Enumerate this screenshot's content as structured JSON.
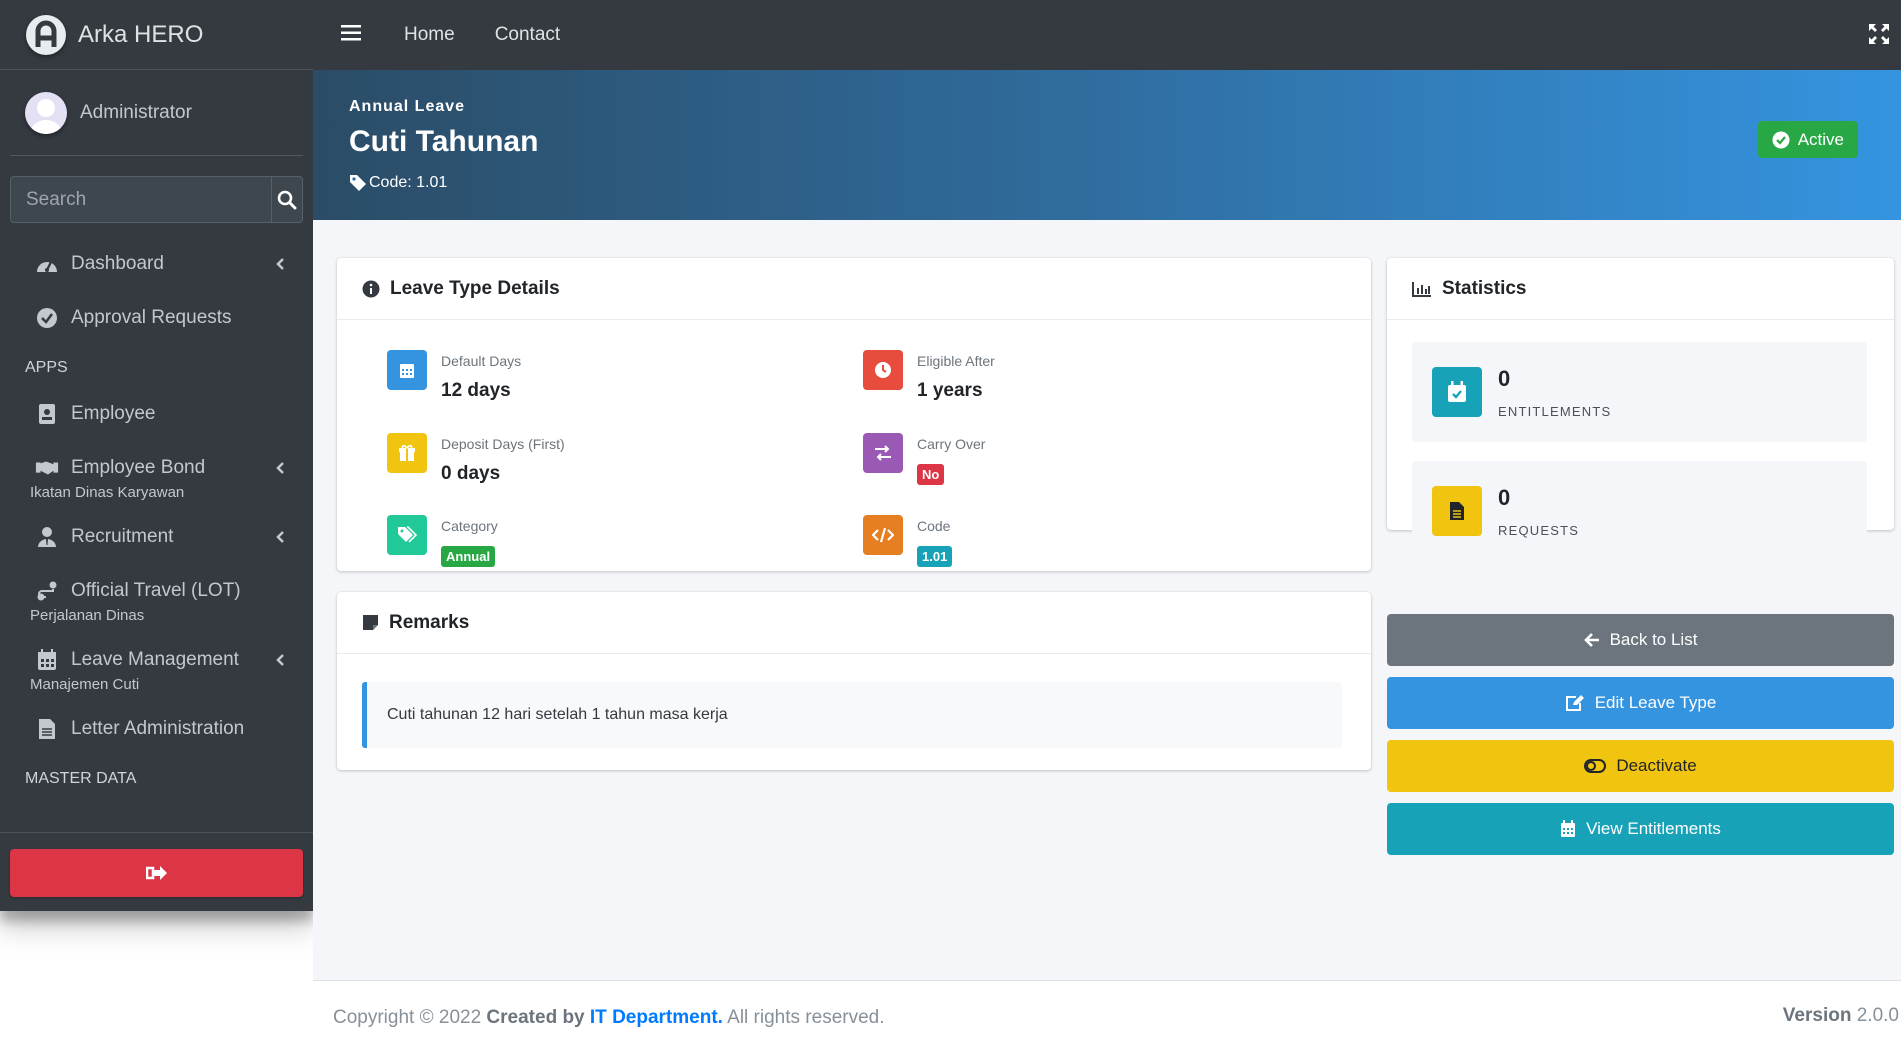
{
  "brand": {
    "name_light": "Arka",
    "name_bold": "HERO"
  },
  "user": {
    "name": "Administrator"
  },
  "search": {
    "placeholder": "Search"
  },
  "sidebar": {
    "items": [
      {
        "label": "Dashboard",
        "sub": ""
      },
      {
        "label": "Approval Requests",
        "sub": ""
      },
      {
        "label": "Employee",
        "sub": ""
      },
      {
        "label": "Employee Bond",
        "sub": "Ikatan Dinas Karyawan"
      },
      {
        "label": "Recruitment",
        "sub": ""
      },
      {
        "label": "Official Travel (LOT)",
        "sub": "Perjalanan Dinas"
      },
      {
        "label": "Leave Management",
        "sub": "Manajemen Cuti"
      },
      {
        "label": "Letter Administration",
        "sub": ""
      }
    ],
    "headers": {
      "apps": "APPS",
      "master": "MASTER DATA"
    }
  },
  "topnav": {
    "home": "Home",
    "contact": "Contact"
  },
  "hero": {
    "kicker": "Annual Leave",
    "title": "Cuti Tahunan",
    "code": "Code: 1.01",
    "status": "Active"
  },
  "details": {
    "header": "Leave Type Details",
    "default_days": {
      "label": "Default Days",
      "value": "12 days"
    },
    "eligible_after": {
      "label": "Eligible After",
      "value": "1 years"
    },
    "deposit_days": {
      "label": "Deposit Days (First)",
      "value": "0 days"
    },
    "carry_over": {
      "label": "Carry Over",
      "value": "No"
    },
    "category": {
      "label": "Category",
      "value": "Annual"
    },
    "code": {
      "label": "Code",
      "value": "1.01"
    }
  },
  "remarks": {
    "header": "Remarks",
    "text": "Cuti tahunan 12 hari setelah 1 tahun masa kerja"
  },
  "statistics": {
    "header": "Statistics",
    "entitlements": {
      "value": "0",
      "label": "ENTITLEMENTS"
    },
    "requests": {
      "value": "0",
      "label": "REQUESTS"
    }
  },
  "actions": {
    "back": "Back to List",
    "edit": "Edit Leave Type",
    "deactivate": "Deactivate",
    "entitlements": "View Entitlements"
  },
  "footer": {
    "copyright": "Copyright © 2022 ",
    "created_by": "Created by ",
    "dept": "IT Department.",
    "rights": " All rights reserved.",
    "version_label": "Version",
    "version": " 2.0.0"
  },
  "colors": {
    "sidebar_bg": "#343a40",
    "primary": "#3594e0",
    "success": "#28a745",
    "danger": "#dc3545",
    "warning": "#f1c40f",
    "info": "#17a2b8",
    "secondary": "#6c757d",
    "purple": "#9b59b6",
    "orange": "#e67e22"
  }
}
